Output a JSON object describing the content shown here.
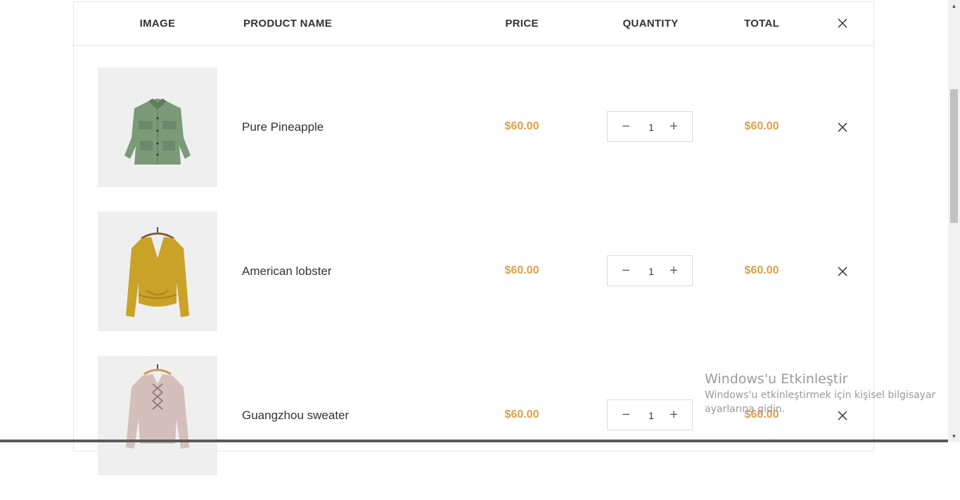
{
  "table": {
    "headers": {
      "image": "IMAGE",
      "product_name": "PRODUCT NAME",
      "price": "PRICE",
      "quantity": "QUANTITY",
      "total": "TOTAL"
    },
    "remove_all_icon": "close-icon"
  },
  "items": [
    {
      "name": "Pure Pineapple",
      "price": "$60.00",
      "quantity": "1",
      "total": "$60.00",
      "image": "green-jacket"
    },
    {
      "name": "American lobster",
      "price": "$60.00",
      "quantity": "1",
      "total": "$60.00",
      "image": "mustard-sweater"
    },
    {
      "name": "Guangzhou sweater",
      "price": "$60.00",
      "quantity": "1",
      "total": "$60.00",
      "image": "pink-sweater"
    }
  ],
  "qty_controls": {
    "minus": "−",
    "plus": "+"
  },
  "colors": {
    "accent_price": "#d9a14a",
    "border": "#e5e5e5",
    "thumb_bg": "#efefef"
  },
  "watermark": {
    "title": "Windows'u Etkinleştir",
    "subtitle": "Windows'u etkinleştirmek için kişisel bilgisayar ayarlarına gidin."
  }
}
